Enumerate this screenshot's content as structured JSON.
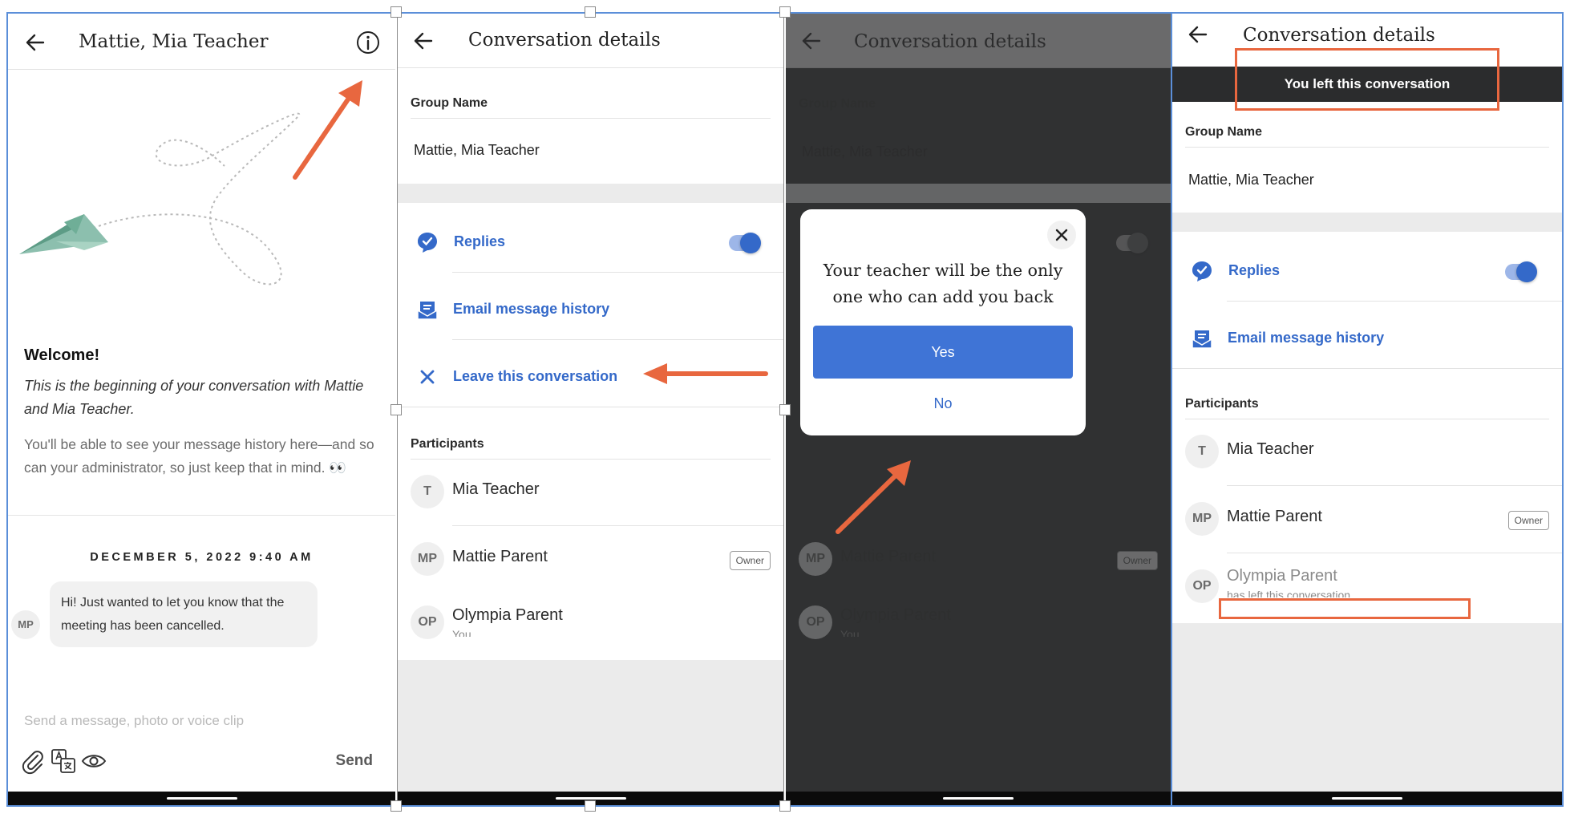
{
  "colors": {
    "accent_blue": "#3469c9",
    "annotation_orange": "#e8673f",
    "frame_blue": "#5b8fd9",
    "modal_overlay": "#313233"
  },
  "chat": {
    "title": "Mattie, Mia Teacher",
    "welcome_heading": "Welcome!",
    "welcome_italic": "This is the beginning of your conversation with Mattie and Mia Teacher.",
    "welcome_body": "You'll be able to see your message history here—and so can your administrator, so just keep that in mind. 👀",
    "date_label": "DECEMBER 5, 2022 9:40 AM",
    "message": {
      "sender_initials": "MP",
      "text": "Hi! Just wanted to let you know that the meeting has been cancelled."
    },
    "compose_placeholder": "Send a message, photo or voice clip",
    "send_label": "Send",
    "icons": [
      "back-arrow-icon",
      "info-icon",
      "paperclip-icon",
      "translate-icon",
      "eye-icon"
    ]
  },
  "details": {
    "title": "Conversation details",
    "group_name_label": "Group Name",
    "group_name_value": "Mattie, Mia Teacher",
    "options": {
      "replies": "Replies",
      "replies_enabled": true,
      "email_history": "Email message history",
      "leave": "Leave this conversation"
    },
    "participants_label": "Participants",
    "participants": [
      {
        "initials": "T",
        "name": "Mia Teacher",
        "sub": "",
        "owner": false
      },
      {
        "initials": "MP",
        "name": "Mattie Parent",
        "sub": "",
        "owner": true
      },
      {
        "initials": "OP",
        "name": "Olympia Parent",
        "sub": "You",
        "owner": false
      }
    ],
    "owner_tag": "Owner"
  },
  "modal": {
    "message": "Your teacher will be the only one who can add you back",
    "yes_label": "Yes",
    "no_label": "No"
  },
  "after_leave": {
    "banner": "You left this conversation",
    "left_sub": "has left this conversation"
  }
}
